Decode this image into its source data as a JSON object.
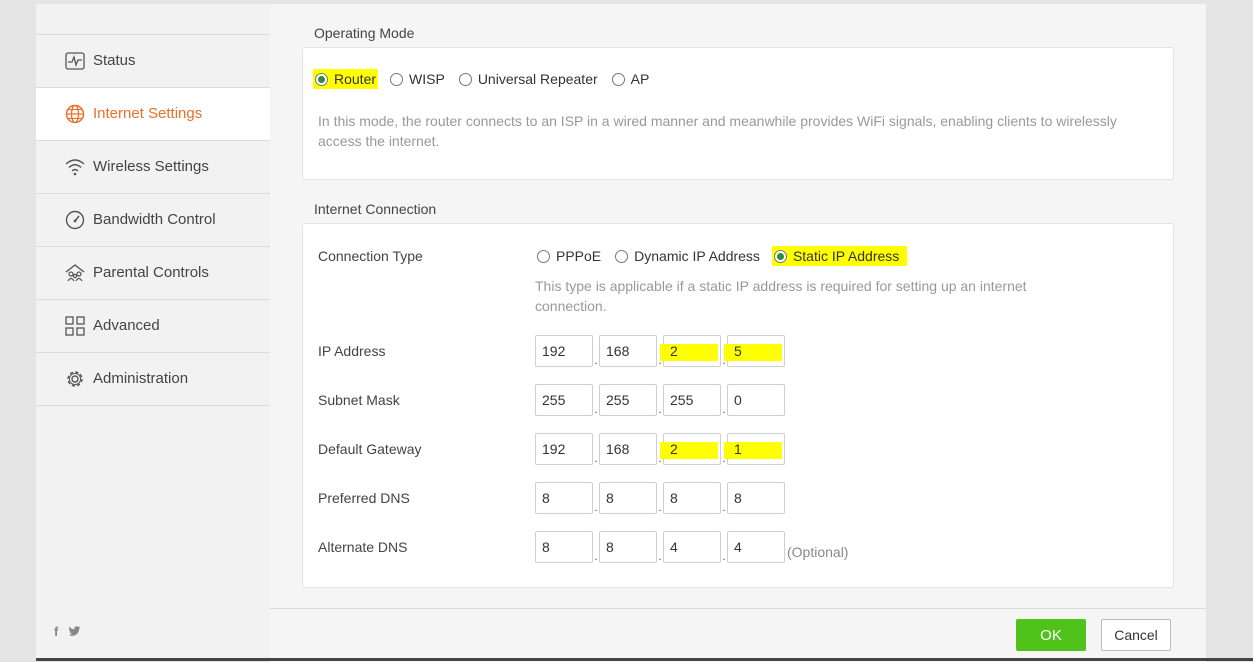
{
  "sidebar": {
    "items": [
      {
        "label": "Status",
        "icon": "pulse-icon"
      },
      {
        "label": "Internet Settings",
        "icon": "globe-icon",
        "active": true
      },
      {
        "label": "Wireless Settings",
        "icon": "wifi-icon"
      },
      {
        "label": "Bandwidth Control",
        "icon": "gauge-icon"
      },
      {
        "label": "Parental Controls",
        "icon": "family-icon"
      },
      {
        "label": "Advanced",
        "icon": "grid-icon"
      },
      {
        "label": "Administration",
        "icon": "gear-icon"
      }
    ],
    "social": {
      "facebook": "f",
      "twitter": "t"
    }
  },
  "operating_mode": {
    "title": "Operating Mode",
    "options": [
      "Router",
      "WISP",
      "Universal Repeater",
      "AP"
    ],
    "selected": "Router",
    "description": "In this mode, the router connects to an ISP in a wired manner and meanwhile provides WiFi signals, enabling clients to wirelessly access the internet."
  },
  "internet_connection": {
    "title": "Internet Connection",
    "connection_type_label": "Connection Type",
    "options": [
      "PPPoE",
      "Dynamic IP Address",
      "Static IP Address"
    ],
    "selected": "Static IP Address",
    "description": "This type is applicable if a static IP address is required for setting up an internet connection.",
    "fields": {
      "ip_address": {
        "label": "IP Address",
        "octets": [
          "192",
          "168",
          "2",
          "5"
        ]
      },
      "subnet_mask": {
        "label": "Subnet Mask",
        "octets": [
          "255",
          "255",
          "255",
          "0"
        ]
      },
      "default_gateway": {
        "label": "Default Gateway",
        "octets": [
          "192",
          "168",
          "2",
          "1"
        ]
      },
      "preferred_dns": {
        "label": "Preferred DNS",
        "octets": [
          "8",
          "8",
          "8",
          "8"
        ]
      },
      "alternate_dns": {
        "label": "Alternate DNS",
        "octets": [
          "8",
          "8",
          "4",
          "4"
        ],
        "suffix": "(Optional)"
      }
    }
  },
  "footer": {
    "ok_label": "OK",
    "cancel_label": "Cancel"
  },
  "colors": {
    "accent": "#e8702a",
    "ok_button": "#4fc31a",
    "radio_on": "#2e8b3e",
    "highlight": "#ffff00"
  }
}
